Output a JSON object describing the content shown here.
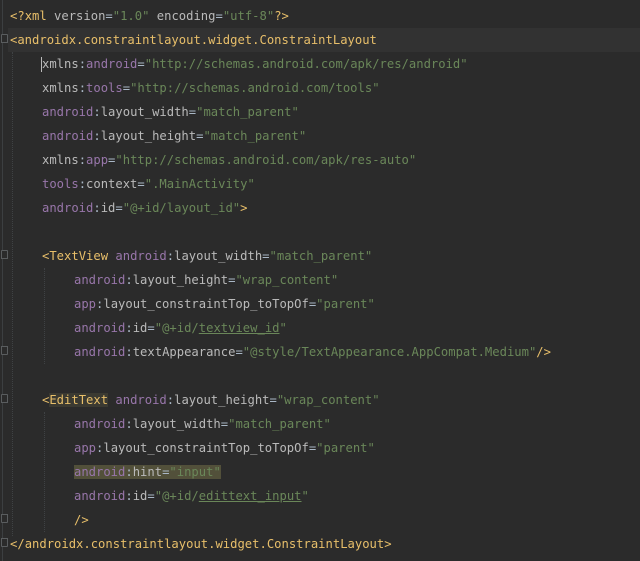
{
  "editor": {
    "language": "xml",
    "background_color": "#2b2b2b",
    "lines": [
      {
        "indent": 0,
        "tokens": [
          {
            "c": "t-punct",
            "t": "<?"
          },
          {
            "c": "t-tag",
            "t": "xml"
          },
          {
            "c": "t-attr",
            "t": " version"
          },
          {
            "c": "t-eq",
            "t": "="
          },
          {
            "c": "t-val",
            "t": "\"1.0\""
          },
          {
            "c": "t-attr",
            "t": " encoding"
          },
          {
            "c": "t-eq",
            "t": "="
          },
          {
            "c": "t-val",
            "t": "\"utf-8\""
          },
          {
            "c": "t-punct",
            "t": "?>"
          }
        ]
      },
      {
        "indent": 0,
        "tokens": [
          {
            "c": "t-punct",
            "t": "<"
          },
          {
            "c": "t-tag",
            "t": "androidx.constraintlayout.widget.ConstraintLayout"
          }
        ]
      },
      {
        "indent": 1,
        "tokens": [
          {
            "c": "t-attr",
            "t": "xmlns"
          },
          {
            "c": "t-eq",
            "t": ":"
          },
          {
            "c": "t-ns",
            "t": "android"
          },
          {
            "c": "t-eq",
            "t": "="
          },
          {
            "c": "t-val",
            "t": "\"http://schemas.android.com/apk/res/android\""
          }
        ]
      },
      {
        "indent": 1,
        "tokens": [
          {
            "c": "t-attr",
            "t": "xmlns"
          },
          {
            "c": "t-eq",
            "t": ":"
          },
          {
            "c": "t-ns",
            "t": "tools"
          },
          {
            "c": "t-eq",
            "t": "="
          },
          {
            "c": "t-val",
            "t": "\"http://schemas.android.com/tools\""
          }
        ]
      },
      {
        "indent": 1,
        "tokens": [
          {
            "c": "t-ns",
            "t": "android"
          },
          {
            "c": "t-eq",
            "t": ":"
          },
          {
            "c": "t-attr",
            "t": "layout_width"
          },
          {
            "c": "t-eq",
            "t": "="
          },
          {
            "c": "t-val",
            "t": "\"match_parent\""
          }
        ]
      },
      {
        "indent": 1,
        "tokens": [
          {
            "c": "t-ns",
            "t": "android"
          },
          {
            "c": "t-eq",
            "t": ":"
          },
          {
            "c": "t-attr",
            "t": "layout_height"
          },
          {
            "c": "t-eq",
            "t": "="
          },
          {
            "c": "t-val",
            "t": "\"match_parent\""
          }
        ]
      },
      {
        "indent": 1,
        "tokens": [
          {
            "c": "t-attr",
            "t": "xmlns"
          },
          {
            "c": "t-eq",
            "t": ":"
          },
          {
            "c": "t-ns",
            "t": "app"
          },
          {
            "c": "t-eq",
            "t": "="
          },
          {
            "c": "t-val",
            "t": "\"http://schemas.android.com/apk/res-auto\""
          }
        ]
      },
      {
        "indent": 1,
        "tokens": [
          {
            "c": "t-ns",
            "t": "tools"
          },
          {
            "c": "t-eq",
            "t": ":"
          },
          {
            "c": "t-attr",
            "t": "context"
          },
          {
            "c": "t-eq",
            "t": "="
          },
          {
            "c": "t-val",
            "t": "\".MainActivity\""
          }
        ]
      },
      {
        "indent": 1,
        "tokens": [
          {
            "c": "t-ns",
            "t": "android"
          },
          {
            "c": "t-eq",
            "t": ":"
          },
          {
            "c": "t-attr",
            "t": "id"
          },
          {
            "c": "t-eq",
            "t": "="
          },
          {
            "c": "t-val",
            "t": "\"@+id/layout_id\""
          },
          {
            "c": "t-punct",
            "t": ">"
          }
        ]
      },
      {
        "indent": 0,
        "tokens": []
      },
      {
        "indent": 1,
        "tokens": [
          {
            "c": "t-punct",
            "t": "<"
          },
          {
            "c": "t-tag",
            "t": "TextView"
          },
          {
            "c": "t-plain",
            "t": " "
          },
          {
            "c": "t-ns",
            "t": "android"
          },
          {
            "c": "t-eq",
            "t": ":"
          },
          {
            "c": "t-attr",
            "t": "layout_width"
          },
          {
            "c": "t-eq",
            "t": "="
          },
          {
            "c": "t-val",
            "t": "\"match_parent\""
          }
        ]
      },
      {
        "indent": 2,
        "tokens": [
          {
            "c": "t-ns",
            "t": "android"
          },
          {
            "c": "t-eq",
            "t": ":"
          },
          {
            "c": "t-attr",
            "t": "layout_height"
          },
          {
            "c": "t-eq",
            "t": "="
          },
          {
            "c": "t-val",
            "t": "\"wrap_content\""
          }
        ]
      },
      {
        "indent": 2,
        "tokens": [
          {
            "c": "t-ns",
            "t": "app"
          },
          {
            "c": "t-eq",
            "t": ":"
          },
          {
            "c": "t-attr",
            "t": "layout_constraintTop_toTopOf"
          },
          {
            "c": "t-eq",
            "t": "="
          },
          {
            "c": "t-val",
            "t": "\"parent\""
          }
        ]
      },
      {
        "indent": 2,
        "tokens": [
          {
            "c": "t-ns",
            "t": "android"
          },
          {
            "c": "t-eq",
            "t": ":"
          },
          {
            "c": "t-attr",
            "t": "id"
          },
          {
            "c": "t-eq",
            "t": "="
          },
          {
            "c": "t-val",
            "t": "\"@+id/"
          },
          {
            "c": "t-val t-uline",
            "t": "textview_id"
          },
          {
            "c": "t-val",
            "t": "\""
          }
        ]
      },
      {
        "indent": 2,
        "tokens": [
          {
            "c": "t-ns",
            "t": "android"
          },
          {
            "c": "t-eq",
            "t": ":"
          },
          {
            "c": "t-attr",
            "t": "textAppearance"
          },
          {
            "c": "t-eq",
            "t": "="
          },
          {
            "c": "t-val",
            "t": "\"@style/TextAppearance.AppCompat.Medium\""
          },
          {
            "c": "t-punct",
            "t": "/>"
          }
        ]
      },
      {
        "indent": 0,
        "tokens": []
      },
      {
        "indent": 1,
        "tokens": [
          {
            "c": "t-punct",
            "t": "<"
          },
          {
            "c": "t-tag hl-tag",
            "t": "EditText"
          },
          {
            "c": "t-plain",
            "t": " "
          },
          {
            "c": "t-ns",
            "t": "android"
          },
          {
            "c": "t-eq",
            "t": ":"
          },
          {
            "c": "t-attr",
            "t": "layout_height"
          },
          {
            "c": "t-eq",
            "t": "="
          },
          {
            "c": "t-val",
            "t": "\"wrap_content\""
          }
        ]
      },
      {
        "indent": 2,
        "tokens": [
          {
            "c": "t-ns",
            "t": "android"
          },
          {
            "c": "t-eq",
            "t": ":"
          },
          {
            "c": "t-attr",
            "t": "layout_width"
          },
          {
            "c": "t-eq",
            "t": "="
          },
          {
            "c": "t-val",
            "t": "\"match_parent\""
          }
        ]
      },
      {
        "indent": 2,
        "tokens": [
          {
            "c": "t-ns",
            "t": "app"
          },
          {
            "c": "t-eq",
            "t": ":"
          },
          {
            "c": "t-attr",
            "t": "layout_constraintTop_toTopOf"
          },
          {
            "c": "t-eq",
            "t": "="
          },
          {
            "c": "t-val",
            "t": "\"parent\""
          }
        ]
      },
      {
        "indent": 2,
        "tokens": [
          {
            "c": "t-ns hl-attr",
            "t": "android"
          },
          {
            "c": "t-eq hl-attr",
            "t": ":"
          },
          {
            "c": "t-attr hl-attr",
            "t": "hint"
          },
          {
            "c": "t-eq hl-attr",
            "t": "="
          },
          {
            "c": "t-val hl-attr",
            "t": "\"input\""
          }
        ]
      },
      {
        "indent": 2,
        "tokens": [
          {
            "c": "t-ns",
            "t": "android"
          },
          {
            "c": "t-eq",
            "t": ":"
          },
          {
            "c": "t-attr",
            "t": "id"
          },
          {
            "c": "t-eq",
            "t": "="
          },
          {
            "c": "t-val",
            "t": "\"@+id/"
          },
          {
            "c": "t-val t-uline",
            "t": "edittext_input"
          },
          {
            "c": "t-val",
            "t": "\""
          }
        ]
      },
      {
        "indent": 2,
        "tokens": [
          {
            "c": "t-punct",
            "t": "/>"
          }
        ]
      },
      {
        "indent": 0,
        "tokens": [
          {
            "c": "t-punct",
            "t": "</"
          },
          {
            "c": "t-tag",
            "t": "androidx.constraintlayout.widget.ConstraintLayout"
          },
          {
            "c": "t-punct",
            "t": ">"
          }
        ]
      }
    ]
  }
}
